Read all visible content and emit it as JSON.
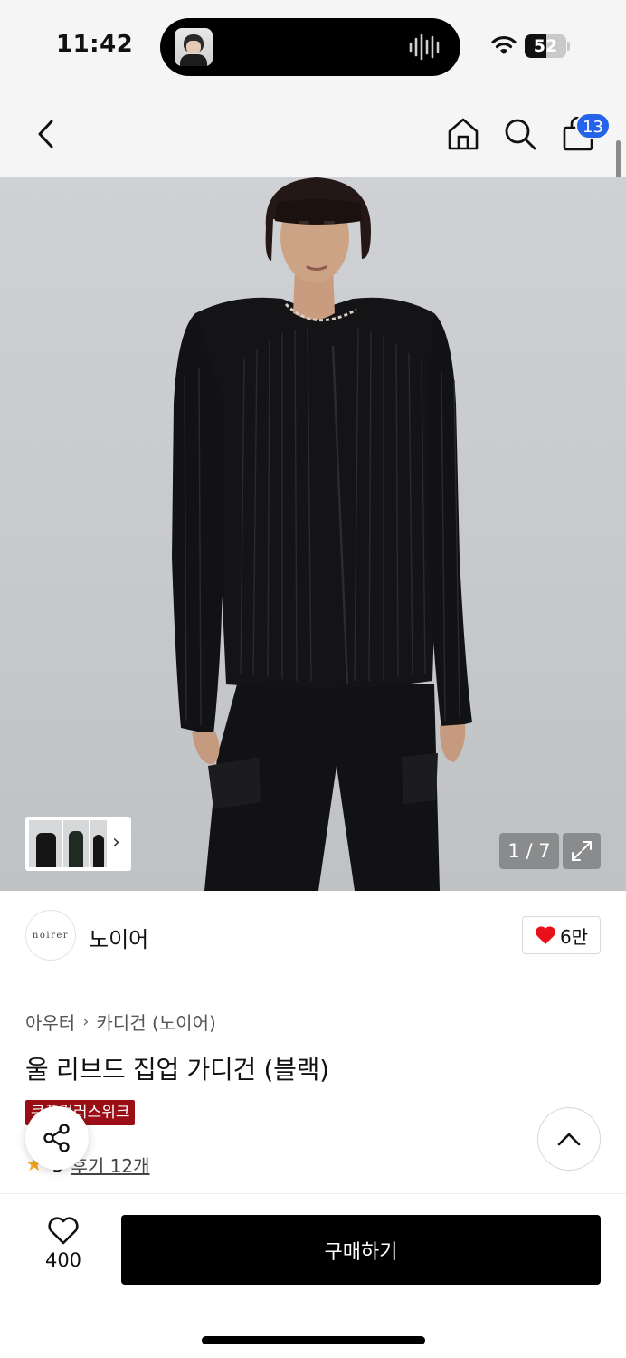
{
  "status_bar": {
    "time": "11:42",
    "battery": "52",
    "battery_level": 0.52
  },
  "header": {
    "back_icon": "chevron-left-icon",
    "home_icon": "home-icon",
    "search_icon": "search-icon",
    "cart_icon": "shopping-bag-icon",
    "cart_count": "13",
    "badge_color": "#2563eb"
  },
  "gallery": {
    "counter": "1 / 7",
    "thumb_chevron": "›",
    "expand_icon": "expand-icon"
  },
  "brand": {
    "logo_text": "noirer",
    "name": "노이어",
    "like_count": "6만",
    "heart_color": "#e8101a"
  },
  "breadcrumb": {
    "category": "아우터",
    "separator": "›",
    "subcategory": "카디건 (노이어)"
  },
  "product": {
    "title": "울 리브드 집업 가디건 (블랙)",
    "event_badge": "쿠폰컬러스위크",
    "rating_star_color": "#f5a623",
    "rating_value": "5",
    "review_link": "후기 12개"
  },
  "actions": {
    "share_icon": "share-icon",
    "scroll_top_icon": "chevron-up-icon",
    "wish_count": "400",
    "buy_label": "구매하기"
  }
}
